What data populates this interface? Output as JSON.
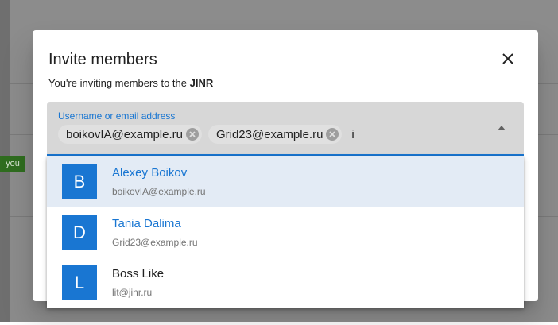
{
  "background": {
    "badge_text": "you"
  },
  "dialog": {
    "title": "Invite members",
    "subtitle_prefix": "You're inviting members to the ",
    "org_name": "JINR"
  },
  "field": {
    "label": "Username or email address",
    "chips": [
      {
        "text": "boikovIA@example.ru"
      },
      {
        "text": "Grid23@example.ru"
      }
    ],
    "typed_text": "i"
  },
  "suggestions": [
    {
      "initial": "B",
      "name": "Alexey Boikov",
      "email": "boikovIA@example.ru",
      "selected": true
    },
    {
      "initial": "D",
      "name": "Tania Dalima",
      "email": "Grid23@example.ru",
      "selected": true
    },
    {
      "initial": "L",
      "name": "Boss Like",
      "email": "lit@jinr.ru",
      "selected": false
    }
  ],
  "colors": {
    "accent": "#1976d2",
    "active_row": "#e3ebf5",
    "field_bg": "#d7d7d7",
    "name_default": "#212121"
  },
  "icons": {
    "close": "close-icon",
    "chip_remove": "cancel-circle-icon",
    "dropdown": "arrow-up-icon"
  }
}
